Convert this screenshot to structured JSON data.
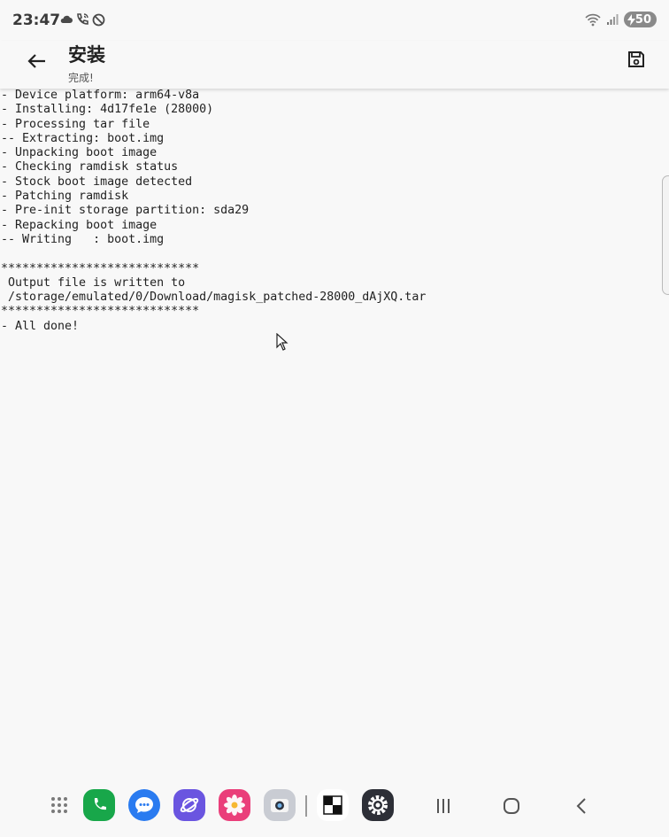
{
  "status_bar": {
    "time": "23:47",
    "left_icons": [
      "cloud-icon",
      "wifi-call-icon",
      "dnd-icon"
    ],
    "right_icons": [
      "wifi-icon",
      "signal-icon"
    ],
    "battery": "50"
  },
  "app_bar": {
    "title": "安装",
    "subtitle": "完成!",
    "back_icon": "arrow-back-icon",
    "save_icon": "save-icon"
  },
  "log_lines": [
    "- Device platform: arm64-v8a",
    "- Installing: 4d17fe1e (28000)",
    "- Processing tar file",
    "-- Extracting: boot.img",
    "- Unpacking boot image",
    "- Checking ramdisk status",
    "- Stock boot image detected",
    "- Patching ramdisk",
    "- Pre-init storage partition: sda29",
    "- Repacking boot image",
    "-- Writing   : boot.img",
    "",
    "****************************",
    " Output file is written to",
    " /storage/emulated/0/Download/magisk_patched-28000_dAjXQ.tar",
    "****************************",
    "- All done!"
  ],
  "dock": {
    "apps": [
      {
        "name": "app-drawer-icon",
        "color": "#888888"
      },
      {
        "name": "phone-app-icon",
        "color": "#18a74a"
      },
      {
        "name": "messages-app-icon",
        "color": "#2a7bf0"
      },
      {
        "name": "internet-app-icon",
        "color": "#6a55e0"
      },
      {
        "name": "gallery-app-icon",
        "color": "#ea3e7a"
      },
      {
        "name": "camera-app-icon",
        "color": "#a6acb8"
      },
      {
        "name": "checkerboard-app-icon",
        "color": "#111111"
      },
      {
        "name": "settings-app-icon",
        "color": "#2d2f37"
      }
    ],
    "nav": [
      "recents-icon",
      "home-icon",
      "back-nav-icon"
    ]
  }
}
